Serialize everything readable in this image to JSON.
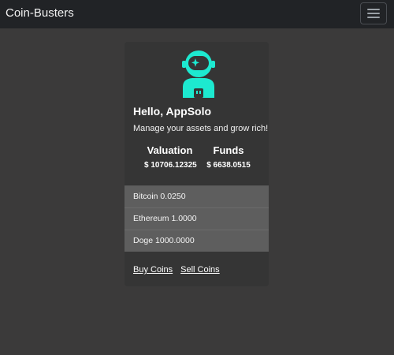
{
  "navbar": {
    "brand": "Coin-Busters",
    "menu_icon": "hamburger-menu-icon"
  },
  "profile": {
    "avatar_icon": "astronaut-icon",
    "accent_color": "#1de9d0",
    "greeting": "Hello, AppSolo",
    "tagline": "Manage your assets and grow rich!"
  },
  "stats": {
    "valuation_label": "Valuation",
    "valuation_value": "$ 10706.12325",
    "funds_label": "Funds",
    "funds_value": "$ 6638.0515"
  },
  "holdings": [
    {
      "label": "Bitcoin 0.0250"
    },
    {
      "label": "Ethereum 1.0000"
    },
    {
      "label": "Doge 1000.0000"
    }
  ],
  "actions": {
    "buy_label": "Buy Coins",
    "sell_label": "Sell Coins"
  }
}
